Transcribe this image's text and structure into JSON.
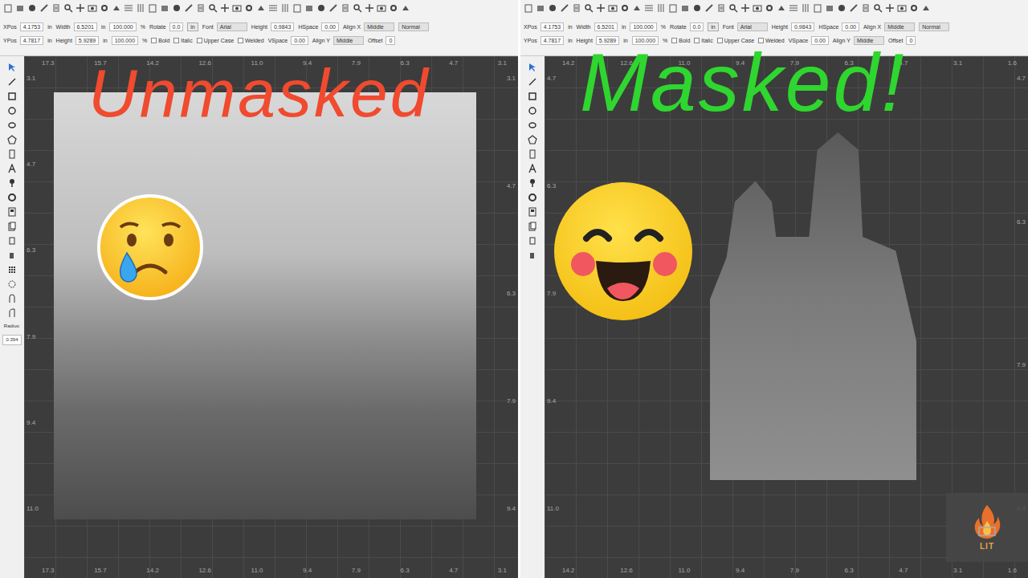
{
  "panes": [
    {
      "caption": {
        "text": "Unmasked",
        "color": "#f04a2f"
      },
      "emoji": {
        "kind": "sad"
      },
      "photo": {
        "kind": "full"
      },
      "toolbar": [
        [
          {
            "kind": "field",
            "label": "XPos",
            "value": "4.1753"
          },
          {
            "kind": "unit",
            "text": "in"
          },
          {
            "kind": "field",
            "label": "Width",
            "value": "6.5201"
          },
          {
            "kind": "unit",
            "text": "in"
          },
          {
            "kind": "value",
            "text": "100.000"
          },
          {
            "kind": "unit",
            "text": "%"
          },
          {
            "kind": "field",
            "label": "Rotate",
            "value": "0.0"
          },
          {
            "kind": "button",
            "text": "in"
          },
          {
            "kind": "select",
            "label": "Font",
            "value": "Arial"
          },
          {
            "kind": "field",
            "label": "Height",
            "value": "0.9843"
          },
          {
            "kind": "field",
            "label": "HSpace",
            "value": "0.00"
          },
          {
            "kind": "select",
            "label": "Align X",
            "value": "Middle"
          },
          {
            "kind": "select",
            "label": "",
            "value": "Normal"
          }
        ],
        [
          {
            "kind": "field",
            "label": "YPos",
            "value": "4.7817"
          },
          {
            "kind": "unit",
            "text": "in"
          },
          {
            "kind": "field",
            "label": "Height",
            "value": "5.9289"
          },
          {
            "kind": "unit",
            "text": "in"
          },
          {
            "kind": "value",
            "text": "100.000"
          },
          {
            "kind": "unit",
            "text": "%"
          },
          {
            "kind": "check",
            "text": "Bold",
            "checked": false
          },
          {
            "kind": "check",
            "text": "Italic",
            "checked": false
          },
          {
            "kind": "check",
            "text": "Upper Case",
            "checked": false
          },
          {
            "kind": "check",
            "text": "Welded",
            "checked": false
          },
          {
            "kind": "field",
            "label": "VSpace",
            "value": "0.00"
          },
          {
            "kind": "select",
            "label": "Align Y",
            "value": "Middle"
          },
          {
            "kind": "field",
            "label": "Offset",
            "value": "0"
          }
        ]
      ],
      "palette": {
        "label": "Radius:",
        "value": "0.394"
      },
      "rulers": {
        "top": [
          "17.3",
          "15.7",
          "14.2",
          "12.6",
          "11.0",
          "9.4",
          "7.9",
          "6.3",
          "4.7",
          "3.1"
        ],
        "bottom": [
          "17.3",
          "15.7",
          "14.2",
          "12.6",
          "11.0",
          "9.4",
          "7.9",
          "6.3",
          "4.7",
          "3.1"
        ],
        "left": [
          "3.1",
          "4.7",
          "6.3",
          "7.9",
          "9.4",
          "11.0"
        ],
        "right": [
          "3.1",
          "4.7",
          "6.3",
          "7.9",
          "9.4"
        ]
      }
    },
    {
      "caption": {
        "text": "Masked!",
        "color": "#2fd62f"
      },
      "emoji": {
        "kind": "happy"
      },
      "photo": {
        "kind": "cut"
      },
      "toolbar": [
        [
          {
            "kind": "field",
            "label": "XPos",
            "value": "4.1753"
          },
          {
            "kind": "unit",
            "text": "in"
          },
          {
            "kind": "field",
            "label": "Width",
            "value": "6.5201"
          },
          {
            "kind": "unit",
            "text": "in"
          },
          {
            "kind": "value",
            "text": "100.000"
          },
          {
            "kind": "unit",
            "text": "%"
          },
          {
            "kind": "field",
            "label": "Rotate",
            "value": "0.0"
          },
          {
            "kind": "button",
            "text": "in"
          },
          {
            "kind": "select",
            "label": "Font",
            "value": "Arial"
          },
          {
            "kind": "field",
            "label": "Height",
            "value": "0.9843"
          },
          {
            "kind": "field",
            "label": "HSpace",
            "value": "0.00"
          },
          {
            "kind": "select",
            "label": "Align X",
            "value": "Middle"
          },
          {
            "kind": "select",
            "label": "",
            "value": "Normal"
          }
        ],
        [
          {
            "kind": "field",
            "label": "YPos",
            "value": "4.7817"
          },
          {
            "kind": "unit",
            "text": "in"
          },
          {
            "kind": "field",
            "label": "Height",
            "value": "5.9289"
          },
          {
            "kind": "unit",
            "text": "in"
          },
          {
            "kind": "value",
            "text": "100.000"
          },
          {
            "kind": "unit",
            "text": "%"
          },
          {
            "kind": "check",
            "text": "Bold",
            "checked": false
          },
          {
            "kind": "check",
            "text": "Italic",
            "checked": false
          },
          {
            "kind": "check",
            "text": "Upper Case",
            "checked": false
          },
          {
            "kind": "check",
            "text": "Welded",
            "checked": false
          },
          {
            "kind": "field",
            "label": "VSpace",
            "value": "0.00"
          },
          {
            "kind": "select",
            "label": "Align Y",
            "value": "Middle"
          },
          {
            "kind": "field",
            "label": "Offset",
            "value": "0"
          }
        ]
      ],
      "rulers": {
        "top": [
          "14.2",
          "12.6",
          "11.0",
          "9.4",
          "7.9",
          "6.3",
          "4.7",
          "3.1",
          "1.6"
        ],
        "bottom": [
          "14.2",
          "12.6",
          "11.0",
          "9.4",
          "7.9",
          "6.3",
          "4.7",
          "3.1",
          "1.6"
        ],
        "left": [
          "4.7",
          "6.3",
          "7.9",
          "9.4",
          "11.0"
        ],
        "right": [
          "4.7",
          "6.3",
          "7.9",
          "9.4"
        ]
      }
    }
  ],
  "watermark": {
    "text": "LIT"
  }
}
